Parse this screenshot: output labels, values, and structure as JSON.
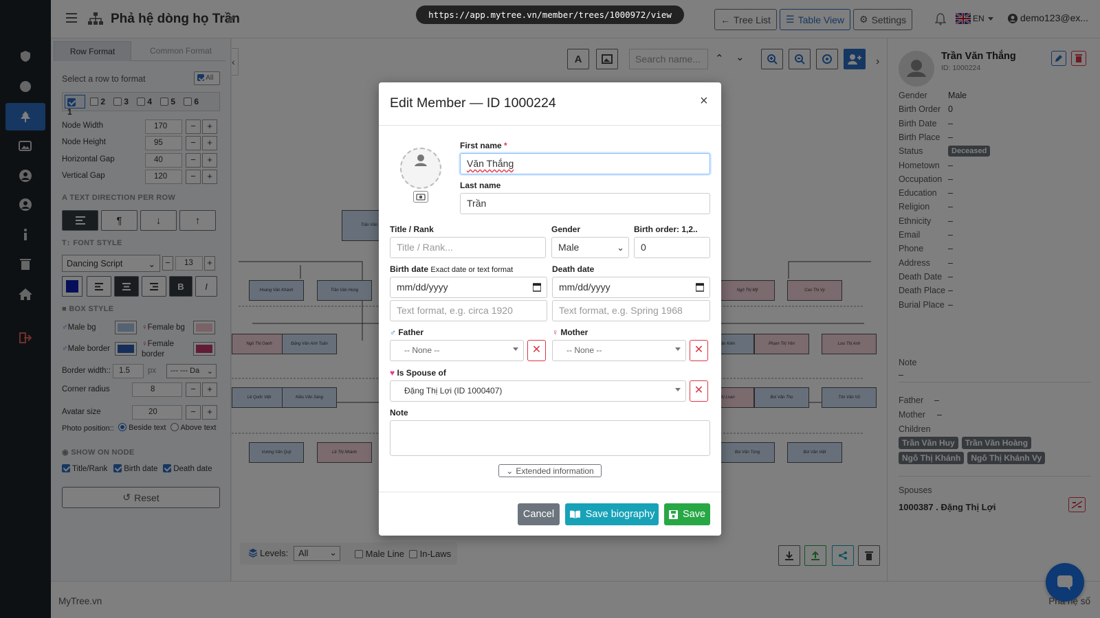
{
  "browser": {
    "url": "https://app.mytree.vn/member/trees/1000972/view"
  },
  "header": {
    "title": "Phả hệ dòng họ Trần",
    "tree_list_label": "Tree List",
    "table_view_label": "Table View",
    "settings_label": "Settings",
    "language": "EN",
    "user": "demo123@ex..."
  },
  "sidebar": {
    "items": [
      {
        "icon": "shield-icon"
      },
      {
        "icon": "circle-icon"
      },
      {
        "icon": "tree-icon",
        "active": true
      },
      {
        "icon": "gallery-icon"
      },
      {
        "icon": "user-circle-icon"
      },
      {
        "icon": "user-circle-alt-icon"
      },
      {
        "icon": "info-icon"
      },
      {
        "icon": "trash-icon"
      },
      {
        "icon": "home-icon"
      },
      {
        "icon": "logout-icon"
      }
    ]
  },
  "left_panel": {
    "tabs": [
      "Row Format",
      "Common Format"
    ],
    "select_row_label": "Select a row to format",
    "all_label": "All",
    "rows": [
      "1",
      "2",
      "3",
      "4",
      "5",
      "6"
    ],
    "node_width_label": "Node Width",
    "node_width": "170",
    "node_height_label": "Node Height",
    "node_height": "95",
    "h_gap_label": "Horizontal Gap",
    "h_gap": "40",
    "v_gap_label": "Vertical Gap",
    "v_gap": "120",
    "text_direction_heading": "TEXT DIRECTION PER ROW",
    "font_style_heading": "FONT STYLE",
    "font_family": "Dancing Script",
    "font_size": "13",
    "bold_label": "B",
    "italic_label": "I",
    "box_style_heading": "BOX STYLE",
    "male_bg_label": "Male bg",
    "female_bg_label": "Female bg",
    "male_border_label": "Male border",
    "female_border_label_1": "Female",
    "female_border_label_2": "border",
    "border_width_label": "Border width::",
    "border_width": "1.5",
    "px_label": "px",
    "border_style": "--- --- Da",
    "corner_radius_label": "Corner radius",
    "corner_radius": "8",
    "avatar_size_label": "Avatar size",
    "avatar_size": "20",
    "photo_position_label": "Photo position::",
    "beside_text_label": "Beside text",
    "above_text_label": "Above text",
    "show_on_node_heading": "SHOW ON NODE",
    "show_title_label": "Title/Rank",
    "show_birth_label": "Birth date",
    "show_death_label": "Death date",
    "reset_label": "Reset",
    "colors": {
      "text": "#0a1fb5",
      "male_bg": "#a9c5e8",
      "female_bg": "#f3c6cf",
      "male_border": "#2d5fb5",
      "female_border": "#c03a6a"
    }
  },
  "canvas": {
    "search_placeholder": "Search name...",
    "levels_label": "Levels:",
    "levels_value": "All",
    "male_line_label": "Male Line",
    "in_laws_label": "In-Laws",
    "nodes": [
      {
        "name": "Trần Văn",
        "gender": "m"
      },
      {
        "name": "Hoàng Văn Khánh",
        "gender": "m"
      },
      {
        "name": "Trần Văn Hùng",
        "gender": "m"
      },
      {
        "name": "Ngô Thị Mỹ",
        "gender": "f"
      },
      {
        "name": "Cao Thị Vy",
        "gender": "f"
      },
      {
        "name": "Ngô Thị Oanh",
        "gender": "f"
      },
      {
        "name": "Đặng Văn Anh Tuấn",
        "gender": "m"
      },
      {
        "name": "Văn Kiên",
        "gender": "m"
      },
      {
        "name": "Phạm Thị Yên",
        "gender": "f"
      },
      {
        "name": "Lưu Thị Anh",
        "gender": "f"
      },
      {
        "name": "Lê Quốc Việt",
        "gender": "m"
      },
      {
        "name": "Kiều Văn Sáng",
        "gender": "m"
      },
      {
        "name": "Thị Loan",
        "gender": "f"
      },
      {
        "name": "Bùi Văn Thọ",
        "gender": "m"
      },
      {
        "name": "Tôn Văn Vũ",
        "gender": "m"
      },
      {
        "name": "Vương Văn Quý",
        "gender": "m"
      },
      {
        "name": "Lê Thị Nhành",
        "gender": "f"
      },
      {
        "name": "Bùi Văn Tùng",
        "gender": "m"
      },
      {
        "name": "Bùi Văn Việt",
        "gender": "m"
      }
    ]
  },
  "right_panel": {
    "name": "Trần Văn Thắng",
    "id": "ID: 1000224",
    "fields": [
      {
        "label": "Gender",
        "value": "Male"
      },
      {
        "label": "Birth Order",
        "value": "0"
      },
      {
        "label": "Birth Date",
        "value": "–"
      },
      {
        "label": "Birth Place",
        "value": "–"
      },
      {
        "label": "Status",
        "value": "Deceased"
      },
      {
        "label": "Hometown",
        "value": "–"
      },
      {
        "label": "Occupation",
        "value": "–"
      },
      {
        "label": "Education",
        "value": "–"
      },
      {
        "label": "Religion",
        "value": "–"
      },
      {
        "label": "Ethnicity",
        "value": "–"
      },
      {
        "label": "Email",
        "value": "–"
      },
      {
        "label": "Phone",
        "value": "–"
      },
      {
        "label": "Address",
        "value": "–"
      },
      {
        "label": "Death Date",
        "value": "–"
      },
      {
        "label": "Death Place",
        "value": "–"
      },
      {
        "label": "Burial Place",
        "value": "–"
      }
    ],
    "note_label": "Note",
    "note_value": "–",
    "father_label": "Father",
    "father_value": "–",
    "mother_label": "Mother",
    "mother_value": "–",
    "children_label": "Children",
    "children": [
      "Trần Văn Huy",
      "Trần Văn Hoàng",
      "Ngô Thị Khánh",
      "Ngô Thị Khánh Vy"
    ],
    "spouses_label": "Spouses",
    "spouse": "1000387 . Đặng Thị Lợi"
  },
  "footer": {
    "brand": "MyTree.vn",
    "right_text": "Phả hệ số"
  },
  "modal": {
    "title": "Edit Member — ID 1000224",
    "first_name_label": "First name",
    "required_mark": "*",
    "first_name_value": "Văn Thắng",
    "last_name_label": "Last name",
    "last_name_value": "Trần",
    "title_rank_label": "Title / Rank",
    "title_rank_placeholder": "Title / Rank...",
    "gender_label": "Gender",
    "gender_value": "Male",
    "birth_order_label": "Birth order: 1,2..",
    "birth_order_value": "0",
    "birth_date_label": "Birth date",
    "birth_date_hint": "Exact date or text format",
    "date_placeholder": "mm/dd/yyyy",
    "birth_text_placeholder": "Text format, e.g. circa 1920",
    "death_date_label": "Death date",
    "death_text_placeholder": "Text format, e.g. Spring 1968",
    "father_label": "Father",
    "father_value": "-- None --",
    "mother_label": "Mother",
    "mother_value": "-- None --",
    "spouse_label": "Is Spouse of",
    "spouse_value": "Đặng Thị Lợi (ID 1000407)",
    "note_label": "Note",
    "extended_label": "Extended information",
    "cancel_label": "Cancel",
    "save_bio_label": "Save biography",
    "save_label": "Save"
  }
}
